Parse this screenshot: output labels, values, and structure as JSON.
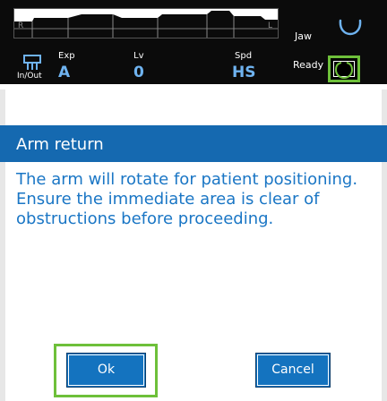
{
  "status_panel": {
    "strip_left_marker": "R",
    "strip_right_marker": "L",
    "jaw_label": "Jaw",
    "inout_label": "In/Out",
    "exp_label": "Exp",
    "exp_value": "A",
    "lv_label": "Lv",
    "lv_value": "0",
    "spd_label": "Spd",
    "spd_value": "HS",
    "ready_label": "Ready"
  },
  "dialog": {
    "title": "Arm return",
    "message": "The arm will rotate for patient positioning. Ensure the immediate area is clear of obstructions before proceeding.",
    "ok_label": "Ok",
    "cancel_label": "Cancel"
  },
  "colors": {
    "accent_blue": "#1569b0",
    "message_blue": "#1a76c5",
    "focus_green": "#6ec03a",
    "value_blue": "#6fb3f0"
  },
  "icons": [
    "jaw-arch-icon",
    "inout-icon",
    "ready-icon"
  ]
}
